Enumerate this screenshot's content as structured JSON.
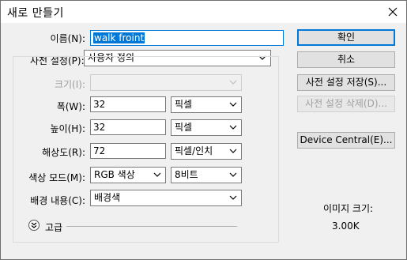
{
  "dialog": {
    "title": "새로 만들기"
  },
  "form": {
    "name_label": "이름(N):",
    "name_value": "walk froint",
    "preset_label": "사전 설정(P):",
    "preset_value": "사용자 정의",
    "size_label": "크기(I):",
    "size_value": "",
    "width_label": "폭(W):",
    "width_value": "32",
    "width_unit": "픽셀",
    "height_label": "높이(H):",
    "height_value": "32",
    "height_unit": "픽셀",
    "resolution_label": "해상도(R):",
    "resolution_value": "72",
    "resolution_unit": "픽셀/인치",
    "color_mode_label": "색상 모드(M):",
    "color_mode_value": "RGB 색상",
    "bit_depth_value": "8비트",
    "background_label": "배경 내용(C):",
    "background_value": "배경색",
    "advanced_label": "고급"
  },
  "buttons": {
    "ok": "확인",
    "cancel": "취소",
    "save_preset": "사전 설정 저장(S)...",
    "delete_preset": "사전 설정 삭제(D)...",
    "device_central": "Device Central(E)..."
  },
  "image_size": {
    "label": "이미지 크기:",
    "value": "3.00K"
  },
  "icons": {
    "close": "close-icon",
    "dropdown": "chevron-down-icon",
    "expand": "expand-icon"
  },
  "colors": {
    "accent": "#0078d7",
    "background": "#f0f0f0"
  }
}
